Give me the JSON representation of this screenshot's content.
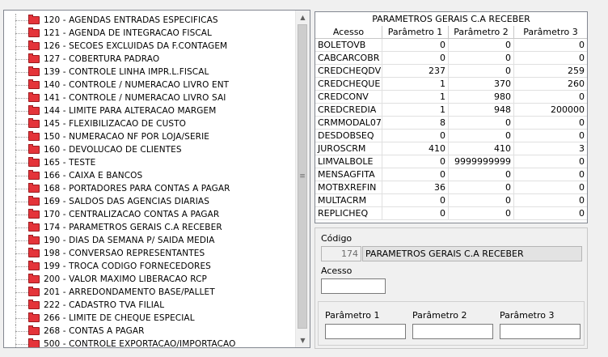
{
  "tree": {
    "items": [
      {
        "label": "120 - AGENDAS ENTRADAS ESPECIFICAS"
      },
      {
        "label": "121 - AGENDA DE INTEGRACAO FISCAL"
      },
      {
        "label": "126 - SECOES EXCLUIDAS DA F.CONTAGEM"
      },
      {
        "label": "127 - COBERTURA PADRAO"
      },
      {
        "label": "139 - CONTROLE LINHA IMPR.L.FISCAL"
      },
      {
        "label": "140 - CONTROLE / NUMERACAO LIVRO ENT"
      },
      {
        "label": "141 - CONTROLE / NUMERACAO LIVRO SAI"
      },
      {
        "label": "144 - LIMITE PARA ALTERACAO MARGEM"
      },
      {
        "label": "145 - FLEXIBILIZACAO DE CUSTO"
      },
      {
        "label": "150 - NUMERACAO NF POR LOJA/SERIE"
      },
      {
        "label": "160 - DEVOLUCAO DE CLIENTES"
      },
      {
        "label": "165 - TESTE"
      },
      {
        "label": "166 - CAIXA E BANCOS"
      },
      {
        "label": "168 - PORTADORES PARA CONTAS A PAGAR"
      },
      {
        "label": "169 - SALDOS DAS AGENCIAS DIARIAS"
      },
      {
        "label": "170 - CENTRALIZACAO CONTAS A PAGAR"
      },
      {
        "label": "174 - PARAMETROS GERAIS C.A RECEBER"
      },
      {
        "label": "190 - DIAS DA SEMANA P/ SAIDA MEDIA"
      },
      {
        "label": "198 - CONVERSAO REPRESENTANTES"
      },
      {
        "label": "199 - TROCA CODIGO FORNECEDORES"
      },
      {
        "label": "200 - VALOR MAXIMO LIBERACAO RCP"
      },
      {
        "label": "201 - ARREDONDAMENTO BASE/PALLET"
      },
      {
        "label": "222 - CADASTRO TVA FILIAL"
      },
      {
        "label": "266 - LIMITE DE CHEQUE ESPECIAL"
      },
      {
        "label": "268 - CONTAS A PAGAR"
      },
      {
        "label": "500 - CONTROLE EXPORTACAO/IMPORTACAO"
      }
    ],
    "scroll_up_icon": "triangle-up",
    "scroll_down_icon": "triangle-down",
    "grip_icon": "grip-lines"
  },
  "grid": {
    "title": "PARAMETROS GERAIS C.A RECEBER",
    "columns": [
      "Acesso",
      "Parâmetro 1",
      "Parâmetro 2",
      "Parâmetro 3"
    ],
    "rows": [
      [
        "BOLETOVB",
        "0",
        "0",
        "0"
      ],
      [
        "CABCARCOBR",
        "0",
        "0",
        "0"
      ],
      [
        "CREDCHEQDV",
        "237",
        "0",
        "259"
      ],
      [
        "CREDCHEQUE",
        "1",
        "370",
        "260"
      ],
      [
        "CREDCONV",
        "1",
        "980",
        "0"
      ],
      [
        "CREDCREDIA",
        "1",
        "948",
        "200000"
      ],
      [
        "CRMMODAL07",
        "8",
        "0",
        "0"
      ],
      [
        "DESDOBSEQ",
        "0",
        "0",
        "0"
      ],
      [
        "JUROSCRM",
        "410",
        "410",
        "3"
      ],
      [
        "LIMVALBOLE",
        "0",
        "9999999999",
        "0"
      ],
      [
        "MENSAGFITA",
        "0",
        "0",
        "0"
      ],
      [
        "MOTBXREFIN",
        "36",
        "0",
        "0"
      ],
      [
        "MULTACRM",
        "0",
        "0",
        "0"
      ],
      [
        "REPLICHEQ",
        "0",
        "0",
        "0"
      ]
    ]
  },
  "form": {
    "codigo_label": "Código",
    "codigo_value": "174",
    "nome_value": "PARAMETROS GERAIS C.A RECEBER",
    "acesso_label": "Acesso",
    "acesso_value": "",
    "param1_label": "Parâmetro 1",
    "param2_label": "Parâmetro 2",
    "param3_label": "Parâmetro 3",
    "param1_value": "",
    "param2_value": "",
    "param3_value": ""
  },
  "colors": {
    "folder_icon": "#e4343a",
    "window_bg": "#f0f0f0",
    "border": "#828790"
  }
}
